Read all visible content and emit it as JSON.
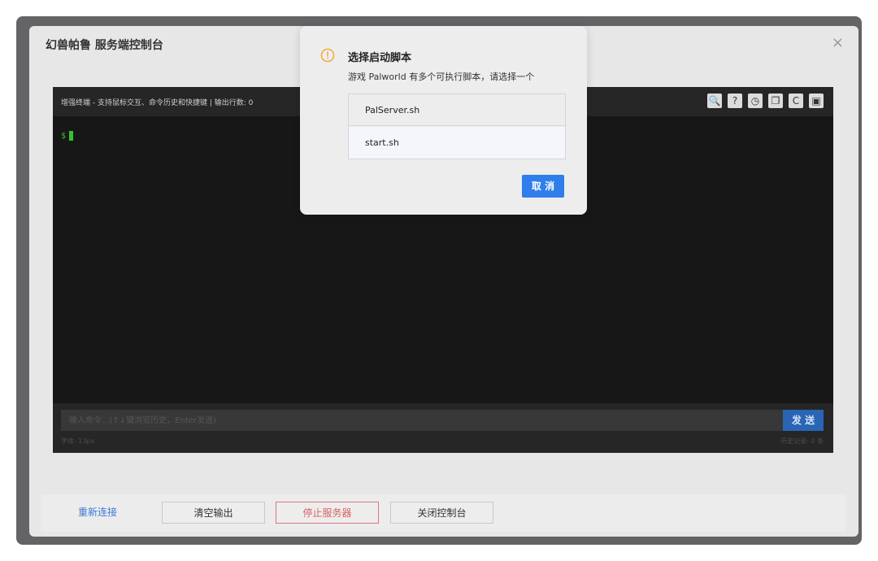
{
  "console": {
    "title": "幻兽帕鲁 服务端控制台",
    "close_symbol": "×",
    "terminal": {
      "header_text": "增强终端 - 支持鼠标交互、命令历史和快捷键 | 输出行数: 0",
      "tools": [
        {
          "icon": "search-icon",
          "glyph": "🔍"
        },
        {
          "icon": "help-icon",
          "glyph": "?"
        },
        {
          "icon": "history-icon",
          "glyph": "◷"
        },
        {
          "icon": "copy-icon",
          "glyph": "❐"
        },
        {
          "icon": "refresh-icon",
          "glyph": "C"
        },
        {
          "icon": "save-icon",
          "glyph": "▣"
        }
      ],
      "prompt": "$",
      "input_placeholder": "输入命令...(↑↓键浏览历史，Enter发送)",
      "send_label": "发 送",
      "font_size_text": "字体: 13px",
      "history_text": "历史记录: 0 条"
    },
    "footer": {
      "reconnect": "重新连接",
      "clear": "清空输出",
      "stop": "停止服务器",
      "close": "关闭控制台"
    }
  },
  "dialog": {
    "title": "选择启动脚本",
    "message": "游戏 Palworld 有多个可执行脚本，请选择一个",
    "scripts": [
      "PalServer.sh",
      "start.sh"
    ],
    "cancel": "取 消",
    "icon": "warning-icon",
    "accent_color": "#f5a623",
    "button_color": "#2f7eeb"
  }
}
